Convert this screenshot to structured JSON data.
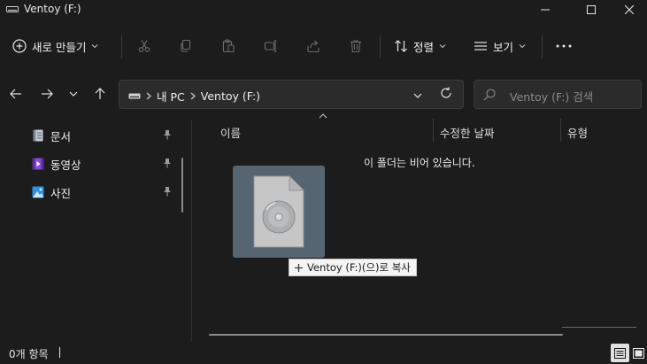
{
  "window": {
    "title": "Ventoy (F:)"
  },
  "toolbar": {
    "new_label": "새로 만들기",
    "sort_label": "정렬",
    "view_label": "보기"
  },
  "address": {
    "crumbs": [
      "내 PC",
      "Ventoy (F:)"
    ]
  },
  "search": {
    "placeholder": "Ventoy (F:) 검색"
  },
  "sidebar": {
    "items": [
      {
        "label": "문서",
        "icon": "document-icon"
      },
      {
        "label": "동영상",
        "icon": "video-icon"
      },
      {
        "label": "사진",
        "icon": "picture-icon"
      }
    ]
  },
  "columns": {
    "name": "이름",
    "modified": "수정한 날짜",
    "type": "유형"
  },
  "content": {
    "empty_message": "이 폴더는 비어 있습니다.",
    "drag_tooltip": "Ventoy (F:)(으)로 복사"
  },
  "status": {
    "item_count": "0개 항목"
  },
  "colors": {
    "background": "#1c1c1c",
    "panel": "#2b2b2b",
    "drag_tile": "#5f7280"
  }
}
